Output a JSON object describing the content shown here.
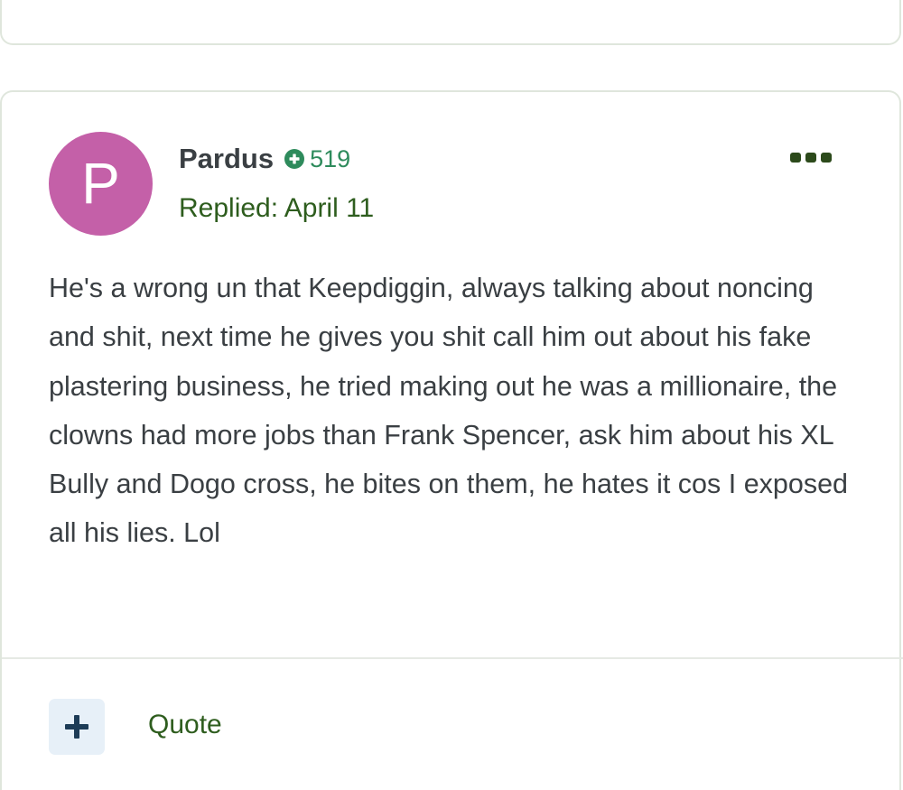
{
  "post": {
    "avatar_letter": "P",
    "author": "Pardus",
    "reputation": "519",
    "replied": "Replied: April 11",
    "body": "He's a wrong un that Keepdiggin, always talking about noncing and shit, next time he gives you shit call him out about his fake plastering business, he tried making out he was a millionaire, the clowns had more jobs than Frank Spencer, ask him about his XL Bully and Dogo cross, he bites on them, he hates it cos I exposed all his lies. Lol",
    "quote_label": "Quote"
  },
  "icons": {
    "reputation": "plus-circle-icon",
    "more": "ellipsis-icon",
    "add": "plus-icon"
  },
  "colors": {
    "avatar": "#c460a8",
    "reputation": "#2e8b5c",
    "accent_green": "#2e5d1e",
    "text": "#3a3f43",
    "button_bg": "#e7f0f8",
    "plus_icon": "#1d3c57"
  }
}
